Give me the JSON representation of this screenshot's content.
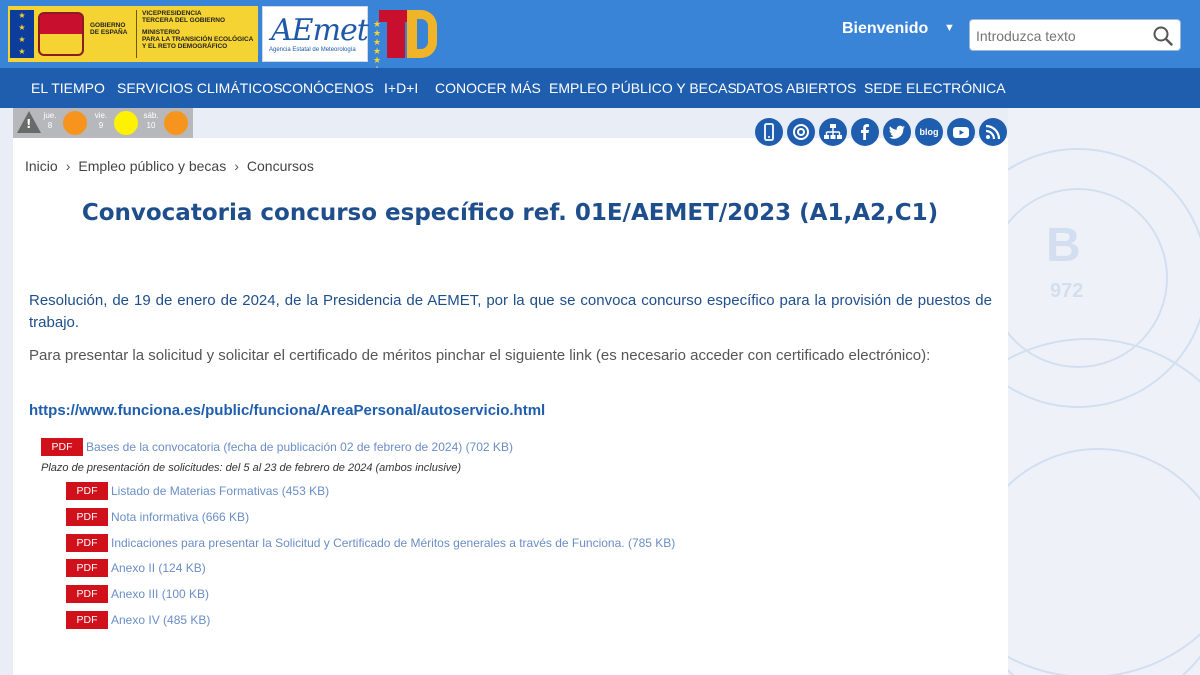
{
  "header": {
    "gov_line1": "GOBIERNO",
    "gov_line2": "DE ESPAÑA",
    "vice_line1": "VICEPRESIDENCIA",
    "vice_line2": "TERCERA DEL GOBIERNO",
    "min_line1": "MINISTERIO",
    "min_line2": "PARA LA TRANSICIÓN ECOLÓGICA",
    "min_line3": "Y EL RETO DEMOGRÁFICO",
    "aemet_logo": "AEmet",
    "aemet_sub": "Agencia Estatal de Meteorología",
    "welcome": "Bienvenido",
    "search_placeholder": "Introduzca texto"
  },
  "nav": [
    "EL TIEMPO",
    "SERVICIOS CLIMÁTICOS",
    "CONÓCENOS",
    "I+D+I",
    "CONOCER MÁS",
    "EMPLEO PÚBLICO Y BECAS",
    "DATOS ABIERTOS",
    "SEDE ELECTRÓNICA"
  ],
  "alerts": {
    "days": [
      {
        "label": "jue.",
        "num": "8",
        "color": "#f7941d"
      },
      {
        "label": "vie.",
        "num": "9",
        "color": "#fff200"
      },
      {
        "label": "sáb.",
        "num": "10",
        "color": "#f7941d"
      }
    ]
  },
  "social_icons": [
    "mobile-icon",
    "support-icon",
    "sitemap-icon",
    "facebook-icon",
    "twitter-icon",
    "blog-icon",
    "youtube-icon",
    "rss-icon"
  ],
  "breadcrumb": [
    "Inicio",
    "Empleo público y becas",
    "Concursos"
  ],
  "title": "Convocatoria concurso específico ref. 01E/AEMET/2023 (A1,A2,C1)",
  "para1": "Resolución, de 19 de enero de 2024, de la Presidencia de AEMET, por la que se convoca concurso específico para la provisión de puestos de trabajo.",
  "para2": "Para presentar la solicitud y solicitar el certificado de méritos pinchar el siguiente link (es necesario acceder con certificado electrónico):",
  "funciona_link": "https://www.funciona.es/public/funciona/AreaPersonal/autoservicio.html",
  "pdf_badge": "PDF",
  "main_doc": "Bases de la convocatoria (fecha de publicación 02 de febrero de 2024) (702 KB)",
  "plazo": "Plazo de presentación de solicitudes: del 5 al 23 de febrero de 2024 (ambos inclusive)",
  "sub_docs": [
    "Listado de Materias Formativas (453 KB)",
    "Nota informativa (666 KB)",
    "Indicaciones para presentar la Solicitud y Certificado de Méritos generales a través de Funciona. (785 KB)",
    "Anexo II (124 KB)",
    "Anexo III (100 KB)",
    "Anexo IV (485 KB)"
  ],
  "background": {
    "letter": "B",
    "number": "972"
  }
}
